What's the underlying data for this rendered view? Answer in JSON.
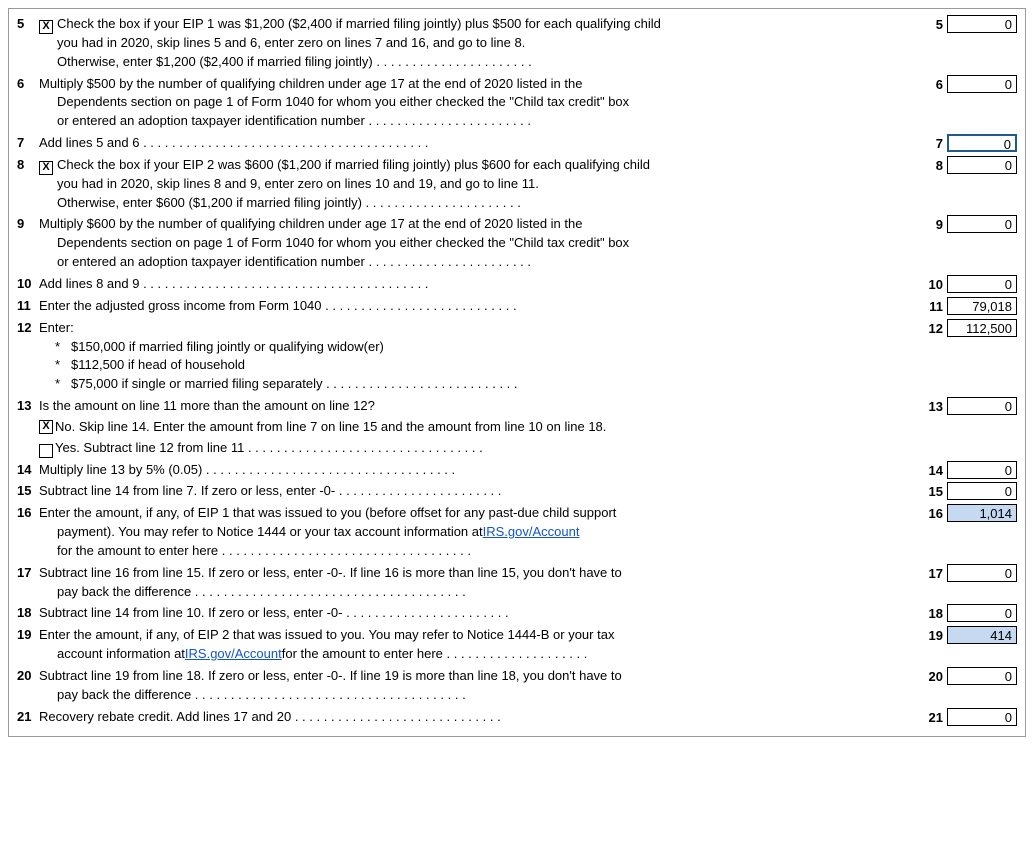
{
  "lines": [
    {
      "num": "5",
      "checkbox": true,
      "checked": true,
      "text_parts": [
        {
          "text": "Check the box if your EIP 1 was $1,200 ($2,400 if married filing jointly) plus $500 for each qualifying child"
        },
        {
          "text": "you had in 2020, skip lines 5 and 6, enter zero on lines 7 and 16, and go to line 8.",
          "indent": true
        },
        {
          "text": "Otherwise, enter $1,200 ($2,400 if married filing jointly) . . . . . . . . . . . . . . . . . . . . . .",
          "indent": true,
          "has_dots": true
        }
      ],
      "field_num": "5",
      "field_val": "0",
      "highlighted": false,
      "outlined": false
    },
    {
      "num": "6",
      "checkbox": false,
      "text_parts": [
        {
          "text": "Multiply $500 by the number of qualifying children under age 17 at the end of 2020 listed in the"
        },
        {
          "text": "Dependents section on page 1 of Form 1040 for whom you either checked the \"Child tax credit\" box",
          "indent": true
        },
        {
          "text": "or entered an adoption taxpayer identification number . . . . . . . . . . . . . . . . . . . . . . .",
          "indent": true,
          "has_dots": true
        }
      ],
      "field_num": "6",
      "field_val": "0",
      "highlighted": false,
      "outlined": false
    },
    {
      "num": "7",
      "simple": true,
      "text": "Add lines 5 and 6 . . . . . . . . . . . . . . . . . . . . . . . . . . . . . . . . . . . . . . . .",
      "field_num": "7",
      "field_val": "0",
      "highlighted": false,
      "outlined": true
    },
    {
      "num": "8",
      "checkbox": true,
      "checked": true,
      "text_parts": [
        {
          "text": "Check the box if your EIP 2 was $600 ($1,200 if married filing jointly) plus $600 for each qualifying child"
        },
        {
          "text": "you had in 2020, skip lines 8 and 9, enter zero on lines 10 and 19, and go to line 11.",
          "indent": true
        },
        {
          "text": "Otherwise, enter $600 ($1,200 if married filing jointly) . . . . . . . . . . . . . . . . . . . . . .",
          "indent": true,
          "has_dots": true
        }
      ],
      "field_num": "8",
      "field_val": "0",
      "highlighted": false,
      "outlined": false
    },
    {
      "num": "9",
      "checkbox": false,
      "text_parts": [
        {
          "text": "Multiply $600 by the number of qualifying children under age 17 at the end of 2020 listed in the"
        },
        {
          "text": "Dependents section on page 1 of Form 1040 for whom you either checked the \"Child tax credit\" box",
          "indent": true
        },
        {
          "text": "or entered an adoption taxpayer identification number . . . . . . . . . . . . . . . . . . . . . . .",
          "indent": true,
          "has_dots": true
        }
      ],
      "field_num": "9",
      "field_val": "0",
      "highlighted": false,
      "outlined": false
    },
    {
      "num": "10",
      "simple": true,
      "text": "Add lines 8 and 9 . . . . . . . . . . . . . . . . . . . . . . . . . . . . . . . . . . . . . . . .",
      "field_num": "10",
      "field_val": "0",
      "highlighted": false,
      "outlined": false
    },
    {
      "num": "11",
      "simple": true,
      "text": "Enter the adjusted gross income from Form 1040 . . . . . . . . . . . . . . . . . . . . . . . . . . .",
      "field_num": "11",
      "field_val": "79,018",
      "highlighted": false,
      "outlined": false
    },
    {
      "num": "12",
      "enter_block": true,
      "label": "Enter:",
      "bullets": [
        "$150,000 if married filing jointly or qualifying widow(er)",
        "$112,500 if head of household",
        "$75,000 if single or married filing separately . . . . . . . . . . . . . . . . . . . . . . . . . . ."
      ],
      "field_num": "12",
      "field_val": "112,500",
      "highlighted": false,
      "outlined": false
    },
    {
      "num": "13",
      "q_block": true,
      "question": "Is the amount on line 11 more than the amount on line 12?",
      "no_checked": true,
      "no_text": "No. Skip line 14. Enter the amount from line 7 on line 15 and the amount from line 10 on line 18.",
      "yes_text": "Yes. Subtract line 12 from line 11 . . . . . . . . . . . . . . . . . . . . . . . . . . . . . . . . .",
      "field_num": "13",
      "field_val": "0",
      "highlighted": false,
      "outlined": false
    },
    {
      "num": "14",
      "simple": true,
      "text": "Multiply line 13 by 5% (0.05) . . . . . . . . . . . . . . . . . . . . . . . . . . . . . . . . . . .",
      "field_num": "14",
      "field_val": "0",
      "highlighted": false,
      "outlined": false
    },
    {
      "num": "15",
      "simple": true,
      "text": "Subtract line 14 from line 7. If zero or less, enter  -0- . . . . . . . . . . . . . . . . . . . . . . .",
      "field_num": "15",
      "field_val": "0",
      "highlighted": false,
      "outlined": false
    },
    {
      "num": "16",
      "text_parts": [
        {
          "text": "Enter the amount, if any, of EIP 1 that was issued to you (before offset for any past-due child support"
        },
        {
          "text": "payment). You may refer to Notice 1444 or your tax account information at",
          "indent": true,
          "link": "IRS.gov/Account",
          "link_after": true
        },
        {
          "text": "for the amount to enter here . . . . . . . . . . . . . . . . . . . . . . . . . . . . . . . . . . .",
          "indent": true,
          "has_dots": true
        }
      ],
      "field_num": "16",
      "field_val": "1,014",
      "highlighted": true,
      "outlined": false
    },
    {
      "num": "17",
      "text_parts": [
        {
          "text": "Subtract line 16 from line 15. If zero or less, enter -0-. If line 16 is more than line 15, you don't have to"
        },
        {
          "text": "pay back the difference . . . . . . . . . . . . . . . . . . . . . . . . . . . . . . . . . . . . . .",
          "indent": true,
          "has_dots": true
        }
      ],
      "field_num": "17",
      "field_val": "0",
      "highlighted": false,
      "outlined": false
    },
    {
      "num": "18",
      "simple": true,
      "text": "Subtract line 14 from line 10. If zero or less, enter -0- . . . . . . . . . . . . . . . . . . . . . . .",
      "field_num": "18",
      "field_val": "0",
      "highlighted": false,
      "outlined": false
    },
    {
      "num": "19",
      "text_parts": [
        {
          "text": "Enter the amount, if any, of EIP 2 that was issued to you. You may refer to Notice 1444-B or your tax"
        },
        {
          "text": "account information at",
          "indent": true,
          "link": "IRS.gov/Account",
          "link_after": true,
          "link_suffix": "  for the amount to enter here . . . . . . . . . . . . . . . . . . . ."
        }
      ],
      "field_num": "19",
      "field_val": "414",
      "highlighted": true,
      "outlined": false
    },
    {
      "num": "20",
      "text_parts": [
        {
          "text": "Subtract line 19 from line 18. If zero or less, enter -0-. If line 19 is more than line 18, you don't have to"
        },
        {
          "text": "pay back the difference . . . . . . . . . . . . . . . . . . . . . . . . . . . . . . . . . . . . . .",
          "indent": true,
          "has_dots": true
        }
      ],
      "field_num": "20",
      "field_val": "0",
      "highlighted": false,
      "outlined": false
    },
    {
      "num": "21",
      "simple": true,
      "text": "Recovery rebate credit. Add lines 17 and 20 . . . . . . . . . . . . . . . . . . . . . . . . . . . . .",
      "field_num": "21",
      "field_val": "0",
      "highlighted": false,
      "outlined": false
    }
  ]
}
